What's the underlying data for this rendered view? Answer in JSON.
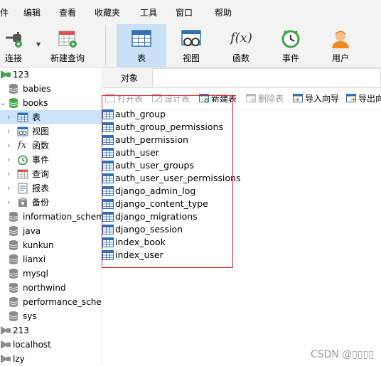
{
  "menubar": {
    "items": [
      "件",
      "编辑",
      "查看",
      "收藏夹",
      "工具",
      "窗口",
      "帮助"
    ]
  },
  "toolbar": {
    "connect_label": "连接",
    "new_query_label": "新建查询",
    "table_label": "表",
    "view_label": "视图",
    "function_label": "函数",
    "event_label": "事件",
    "user_label": "用户",
    "function_icon_text": "f(x)"
  },
  "sidebar": {
    "items": [
      {
        "label": "123",
        "icon": "connection-icon"
      },
      {
        "label": "babies",
        "icon": "database-icon"
      },
      {
        "label": "books",
        "icon": "database-icon-open"
      },
      {
        "label": "表",
        "icon": "table-icon",
        "selected": true
      },
      {
        "label": "视图",
        "icon": "view-icon"
      },
      {
        "label": "函数",
        "icon": "function-icon"
      },
      {
        "label": "事件",
        "icon": "event-icon"
      },
      {
        "label": "查询",
        "icon": "query-icon"
      },
      {
        "label": "报表",
        "icon": "report-icon"
      },
      {
        "label": "备份",
        "icon": "backup-icon"
      },
      {
        "label": "information_schema",
        "icon": "database-icon"
      },
      {
        "label": "java",
        "icon": "database-icon"
      },
      {
        "label": "kunkun",
        "icon": "database-icon"
      },
      {
        "label": "lianxi",
        "icon": "database-icon"
      },
      {
        "label": "mysql",
        "icon": "database-icon"
      },
      {
        "label": "northwind",
        "icon": "database-icon"
      },
      {
        "label": "performance_schema",
        "icon": "database-icon"
      },
      {
        "label": "sys",
        "icon": "database-icon"
      },
      {
        "label": "213",
        "icon": "connection-icon"
      },
      {
        "label": "localhost",
        "icon": "connection-icon"
      },
      {
        "label": "lzy",
        "icon": "connection-icon"
      }
    ]
  },
  "tabs": {
    "objects_label": "对象"
  },
  "object_toolbar": {
    "open_table": "打开表",
    "design_table": "设计表",
    "new_table": "新建表",
    "delete_table": "删除表",
    "import_wizard": "导入向导",
    "export_wizard": "导出向"
  },
  "tables": [
    "auth_group",
    "auth_group_permissions",
    "auth_permission",
    "auth_user",
    "auth_user_groups",
    "auth_user_user_permissions",
    "django_admin_log",
    "django_content_type",
    "django_migrations",
    "django_session",
    "index_book",
    "index_user"
  ],
  "watermark": "CSDN @▯▯▯▯",
  "colors": {
    "selection": "#cce4f7",
    "active_tool": "#c9e0f7",
    "highlight_box": "#e2242b",
    "table_icon_blue": "#2f6fb5",
    "database_icon_gray": "#8a8a8a",
    "database_icon_green": "#3fae49"
  }
}
